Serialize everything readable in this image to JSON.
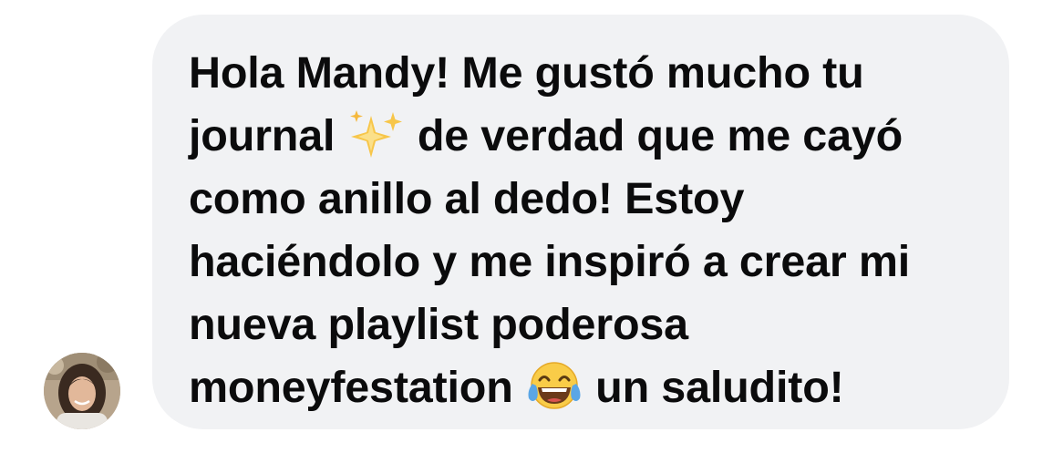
{
  "message": {
    "lines": [
      {
        "text": "Hola Mandy! Me gustó mucho tu"
      },
      {
        "before": "journal ",
        "emoji": "sparkles-emoji",
        "after": " de verdad que me cayó"
      },
      {
        "text": "como anillo al dedo! Estoy"
      },
      {
        "text": "haciéndolo y me inspiró a crear mi"
      },
      {
        "text": "nueva playlist poderosa"
      },
      {
        "before": "moneyfestation ",
        "emoji": "tears-of-joy-emoji",
        "after": " un saludito!"
      }
    ]
  },
  "sender": {
    "avatar": "profile-photo-woman"
  },
  "colors": {
    "bubble": "#f1f2f4",
    "text": "#0b0b0c",
    "background": "#ffffff"
  }
}
